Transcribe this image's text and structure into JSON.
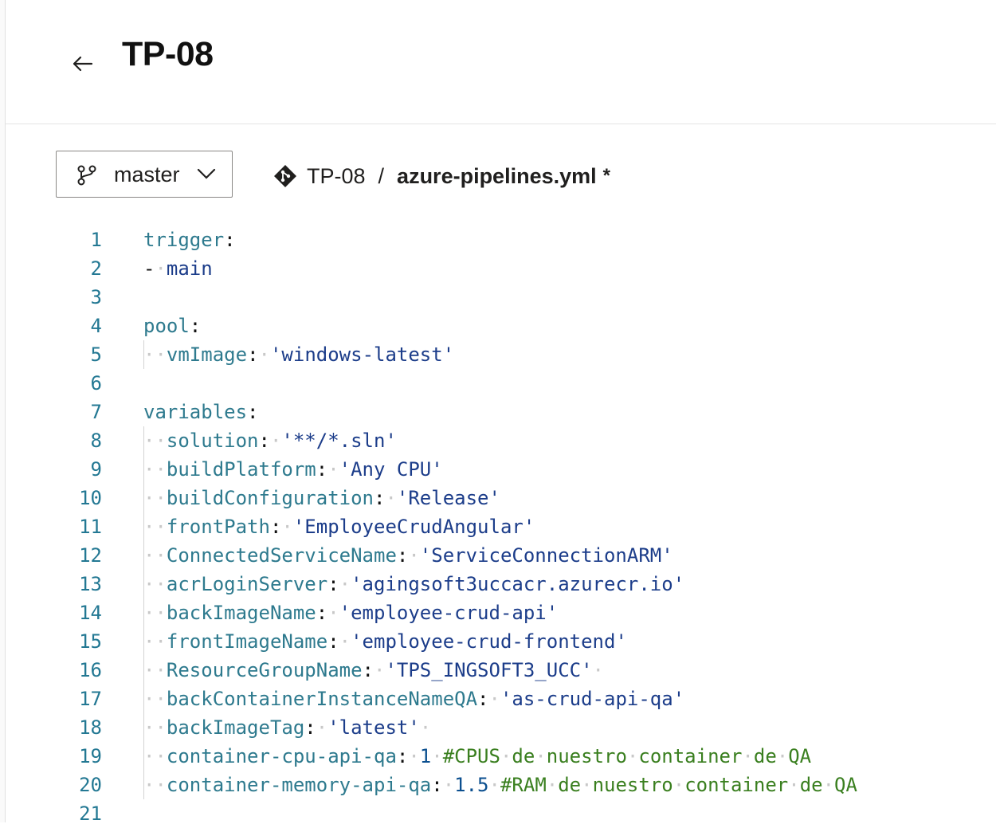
{
  "header": {
    "title": "TP-08",
    "back_icon": "arrow-left-icon"
  },
  "toolbar": {
    "branch": {
      "label": "master",
      "icon": "branch-icon",
      "dropdown_icon": "chevron-down-icon"
    },
    "breadcrumb": {
      "repo_icon": "repo-git-icon",
      "repo": "TP-08",
      "separator": "/",
      "file": "azure-pipelines.yml",
      "dirty_marker": "*"
    }
  },
  "editor": {
    "line_numbers": [
      "1",
      "2",
      "3",
      "4",
      "5",
      "6",
      "7",
      "8",
      "9",
      "10",
      "11",
      "12",
      "13",
      "14",
      "15",
      "16",
      "17",
      "18",
      "19",
      "20",
      "21"
    ],
    "lines": [
      "trigger:",
      "- main",
      "",
      "pool:",
      "  vmImage: 'windows-latest'",
      "",
      "variables:",
      "  solution: '**/*.sln'",
      "  buildPlatform: 'Any CPU'",
      "  buildConfiguration: 'Release'",
      "  frontPath: 'EmployeeCrudAngular'",
      "  ConnectedServiceName: 'ServiceConnectionARM'",
      "  acrLoginServer: 'agingsoft3uccacr.azurecr.io'",
      "  backImageName: 'employee-crud-api'",
      "  frontImageName: 'employee-crud-frontend'",
      "  ResourceGroupName: 'TPS_INGSOFT3_UCC' ",
      "  backContainerInstanceNameQA: 'as-crud-api-qa'",
      "  backImageTag: 'latest' ",
      "  container-cpu-api-qa: 1 #CPUS de nuestro container de QA",
      "  container-memory-api-qa: 1.5 #RAM de nuestro container de QA",
      ""
    ]
  },
  "colors": {
    "key": "#2e7a8e",
    "string": "#1c3d8a",
    "number": "#0b4f8f",
    "comment": "#3a7f1f",
    "line_number": "#237893"
  }
}
